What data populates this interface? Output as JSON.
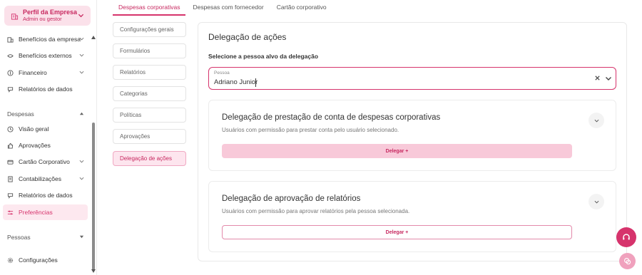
{
  "profile": {
    "name": "Perfil da Empresa",
    "role": "Admin ou gestor"
  },
  "sidebar": {
    "items_top": [
      {
        "label": "Benefícios da empresa",
        "icon": "building-icon"
      },
      {
        "label": "Benefícios externos",
        "icon": "gift-icon"
      },
      {
        "label": "Financeiro",
        "icon": "dollar-icon"
      },
      {
        "label": "Relatórios de dados",
        "icon": "report-icon"
      }
    ],
    "section_despesas": "Despesas",
    "items_despesas": [
      {
        "label": "Visão geral",
        "icon": "clock-icon"
      },
      {
        "label": "Aprovações",
        "icon": "thumbs-up-icon"
      },
      {
        "label": "Cartão Corporativo",
        "icon": "card-icon"
      },
      {
        "label": "Contabilizações",
        "icon": "ledger-icon"
      },
      {
        "label": "Relatórios de dados",
        "icon": "report-icon"
      },
      {
        "label": "Preferências",
        "icon": "sliders-icon"
      }
    ],
    "section_pessoas": "Pessoas",
    "settings": "Configurações"
  },
  "tabs": [
    "Despesas corporativas",
    "Despesas com fornecedor",
    "Cartão corporativo"
  ],
  "submenu": [
    "Configurações gerais",
    "Formulários",
    "Relatórios",
    "Categorias",
    "Políticas",
    "Aprovações",
    "Delegação de ações"
  ],
  "main": {
    "title": "Delegação de ações",
    "subtitle": "Selecione a pessoa alvo da delegação",
    "person_label": "Pessoa",
    "person_value": "Adriano Junior",
    "cards": [
      {
        "title": "Delegação de prestação de conta de despesas corporativas",
        "desc": "Usuários com permissão para prestar conta pelo usuário selecionado.",
        "button": "Delegar +"
      },
      {
        "title": "Delegação de aprovação de relatórios",
        "desc": "Usuários com permissão para aprovar relatórios pela pessoa selecionada.",
        "button": "Delegar +"
      }
    ]
  },
  "colors": {
    "accent": "#d6336c",
    "accent_light": "#fde8ef"
  }
}
